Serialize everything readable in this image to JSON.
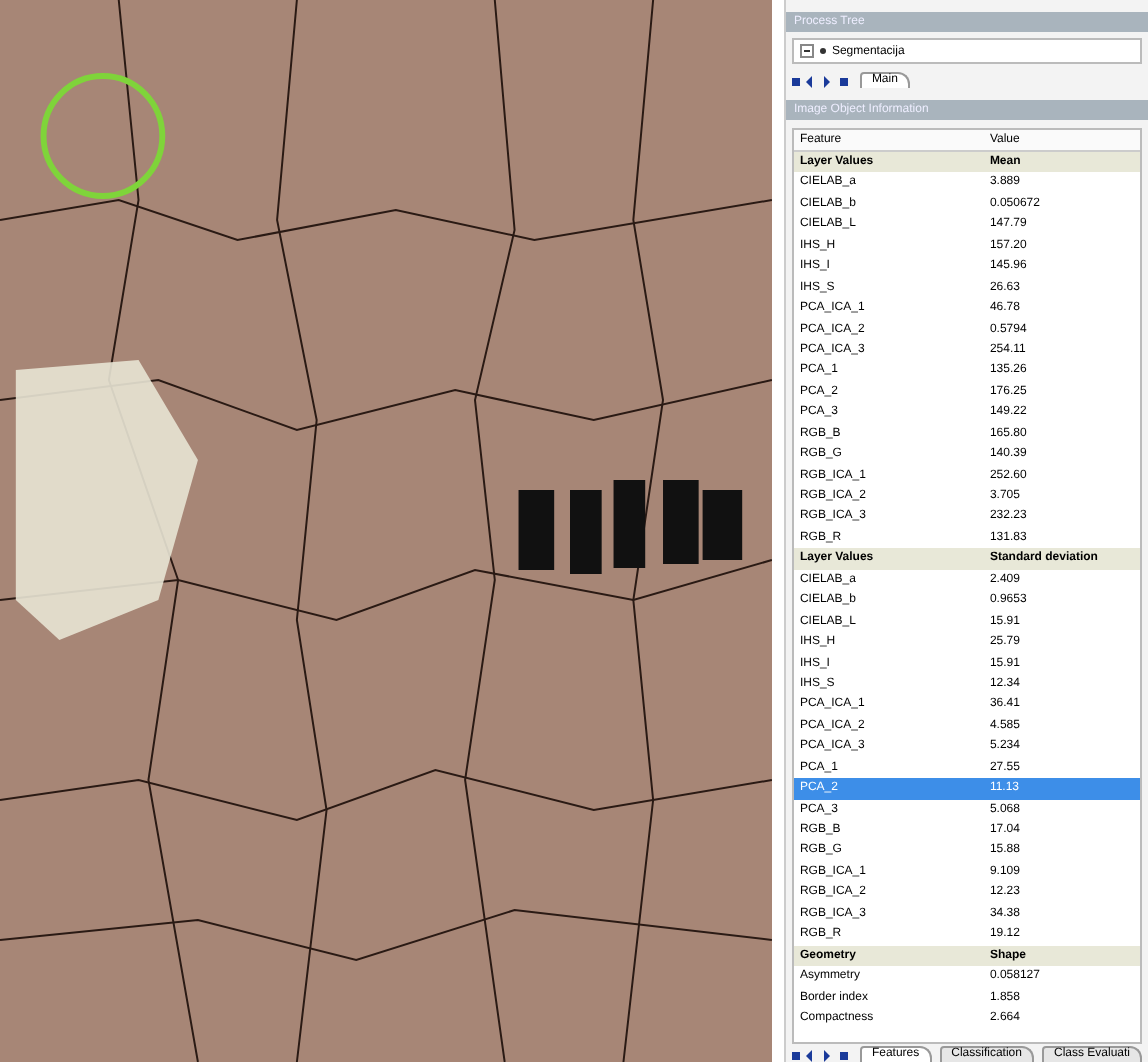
{
  "process_tree": {
    "title": "Process Tree",
    "item": {
      "label": "Segmentacija",
      "expanded": true
    },
    "tabs": [
      {
        "label": "Main",
        "selected": true
      }
    ]
  },
  "image_object_information": {
    "title": "Image Object Information",
    "columns": [
      "Feature",
      "Value"
    ],
    "rows": [
      {
        "kind": "heading",
        "feature": "Layer Values",
        "value": "Mean",
        "selected": false
      },
      {
        "kind": "row",
        "feature": "CIELAB_a",
        "value": "3.889",
        "selected": false
      },
      {
        "kind": "row",
        "feature": "CIELAB_b",
        "value": "0.050672",
        "selected": false
      },
      {
        "kind": "row",
        "feature": "CIELAB_L",
        "value": "147.79",
        "selected": false
      },
      {
        "kind": "row",
        "feature": "IHS_H",
        "value": "157.20",
        "selected": false
      },
      {
        "kind": "row",
        "feature": "IHS_I",
        "value": "145.96",
        "selected": false
      },
      {
        "kind": "row",
        "feature": "IHS_S",
        "value": "26.63",
        "selected": false
      },
      {
        "kind": "row",
        "feature": "PCA_ICA_1",
        "value": "46.78",
        "selected": false
      },
      {
        "kind": "row",
        "feature": "PCA_ICA_2",
        "value": "0.5794",
        "selected": false
      },
      {
        "kind": "row",
        "feature": "PCA_ICA_3",
        "value": "254.11",
        "selected": false
      },
      {
        "kind": "row",
        "feature": "PCA_1",
        "value": "135.26",
        "selected": false
      },
      {
        "kind": "row",
        "feature": "PCA_2",
        "value": "176.25",
        "selected": false
      },
      {
        "kind": "row",
        "feature": "PCA_3",
        "value": "149.22",
        "selected": false
      },
      {
        "kind": "row",
        "feature": "RGB_B",
        "value": "165.80",
        "selected": false
      },
      {
        "kind": "row",
        "feature": "RGB_G",
        "value": "140.39",
        "selected": false
      },
      {
        "kind": "row",
        "feature": "RGB_ICA_1",
        "value": "252.60",
        "selected": false
      },
      {
        "kind": "row",
        "feature": "RGB_ICA_2",
        "value": "3.705",
        "selected": false
      },
      {
        "kind": "row",
        "feature": "RGB_ICA_3",
        "value": "232.23",
        "selected": false
      },
      {
        "kind": "row",
        "feature": "RGB_R",
        "value": "131.83",
        "selected": false
      },
      {
        "kind": "heading",
        "feature": "Layer Values",
        "value": "Standard deviation",
        "selected": false
      },
      {
        "kind": "row",
        "feature": "CIELAB_a",
        "value": "2.409",
        "selected": false
      },
      {
        "kind": "row",
        "feature": "CIELAB_b",
        "value": "0.9653",
        "selected": false
      },
      {
        "kind": "row",
        "feature": "CIELAB_L",
        "value": "15.91",
        "selected": false
      },
      {
        "kind": "row",
        "feature": "IHS_H",
        "value": "25.79",
        "selected": false
      },
      {
        "kind": "row",
        "feature": "IHS_I",
        "value": "15.91",
        "selected": false
      },
      {
        "kind": "row",
        "feature": "IHS_S",
        "value": "12.34",
        "selected": false
      },
      {
        "kind": "row",
        "feature": "PCA_ICA_1",
        "value": "36.41",
        "selected": false
      },
      {
        "kind": "row",
        "feature": "PCA_ICA_2",
        "value": "4.585",
        "selected": false
      },
      {
        "kind": "row",
        "feature": "PCA_ICA_3",
        "value": "5.234",
        "selected": false
      },
      {
        "kind": "row",
        "feature": "PCA_1",
        "value": "27.55",
        "selected": false
      },
      {
        "kind": "row",
        "feature": "PCA_2",
        "value": "11.13",
        "selected": true
      },
      {
        "kind": "row",
        "feature": "PCA_3",
        "value": "5.068",
        "selected": false
      },
      {
        "kind": "row",
        "feature": "RGB_B",
        "value": "17.04",
        "selected": false
      },
      {
        "kind": "row",
        "feature": "RGB_G",
        "value": "15.88",
        "selected": false
      },
      {
        "kind": "row",
        "feature": "RGB_ICA_1",
        "value": "9.109",
        "selected": false
      },
      {
        "kind": "row",
        "feature": "RGB_ICA_2",
        "value": "12.23",
        "selected": false
      },
      {
        "kind": "row",
        "feature": "RGB_ICA_3",
        "value": "34.38",
        "selected": false
      },
      {
        "kind": "row",
        "feature": "RGB_R",
        "value": "19.12",
        "selected": false
      },
      {
        "kind": "heading",
        "feature": "Geometry",
        "value": "Shape",
        "selected": false
      },
      {
        "kind": "row",
        "feature": "Asymmetry",
        "value": "0.058127",
        "selected": false
      },
      {
        "kind": "row",
        "feature": "Border index",
        "value": "1.858",
        "selected": false
      },
      {
        "kind": "row",
        "feature": "Compactness",
        "value": "2.664",
        "selected": false
      }
    ],
    "tabs": [
      {
        "label": "Features",
        "selected": true
      },
      {
        "label": "Classification",
        "selected": false
      },
      {
        "label": "Class Evaluati",
        "selected": false
      }
    ]
  }
}
